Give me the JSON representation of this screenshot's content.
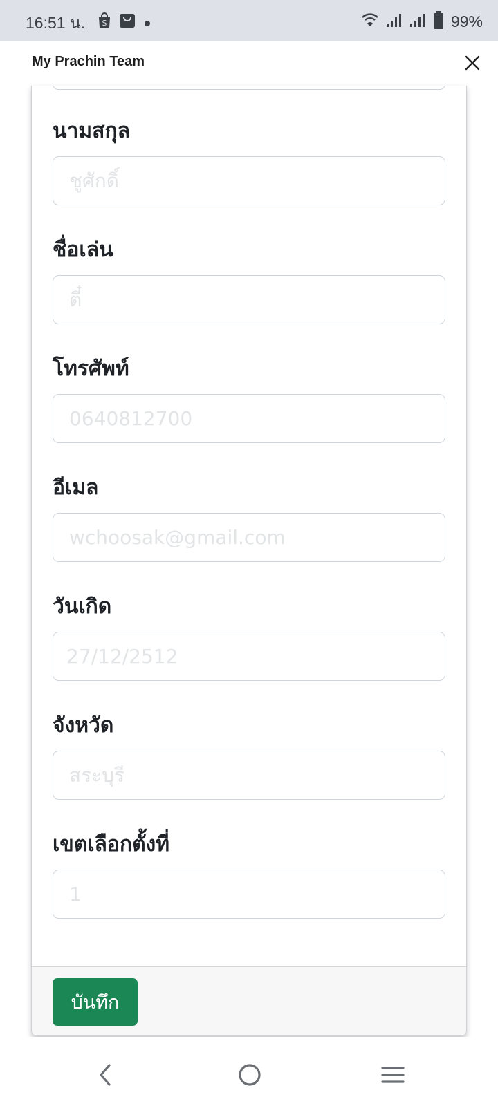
{
  "status_bar": {
    "time": "16:51 น.",
    "battery": "99%",
    "icons": [
      "shop-icon",
      "bag-icon",
      "notification-dot-icon",
      "wifi-icon",
      "signal-icon",
      "signal-icon",
      "battery-icon"
    ]
  },
  "header": {
    "title": "My Prachin Team",
    "close_icon": "close-icon"
  },
  "form": {
    "fields": [
      {
        "label": "นามสกุล",
        "placeholder": "ชูศักดิ์",
        "value": ""
      },
      {
        "label": "ชื่อเล่น",
        "placeholder": "ตี๋",
        "value": ""
      },
      {
        "label": "โทรศัพท์",
        "placeholder": "0640812700",
        "value": ""
      },
      {
        "label": "อีเมล",
        "placeholder": "wchoosak@gmail.com",
        "value": ""
      },
      {
        "label": "วันเกิด",
        "placeholder": "27/12/2512",
        "value": ""
      },
      {
        "label": "จังหวัด",
        "placeholder": "สระบุรี",
        "value": ""
      },
      {
        "label": "เขตเลือกตั้งที่",
        "placeholder": "1",
        "value": ""
      }
    ]
  },
  "footer": {
    "save_label": "บันทึก"
  },
  "nav_bar": {
    "icons": [
      "back-icon",
      "home-icon",
      "recents-icon"
    ]
  },
  "colors": {
    "status_bar_bg": "#dee2e8",
    "save_button": "#1a8754",
    "footer_bg": "#f7f7f7"
  }
}
